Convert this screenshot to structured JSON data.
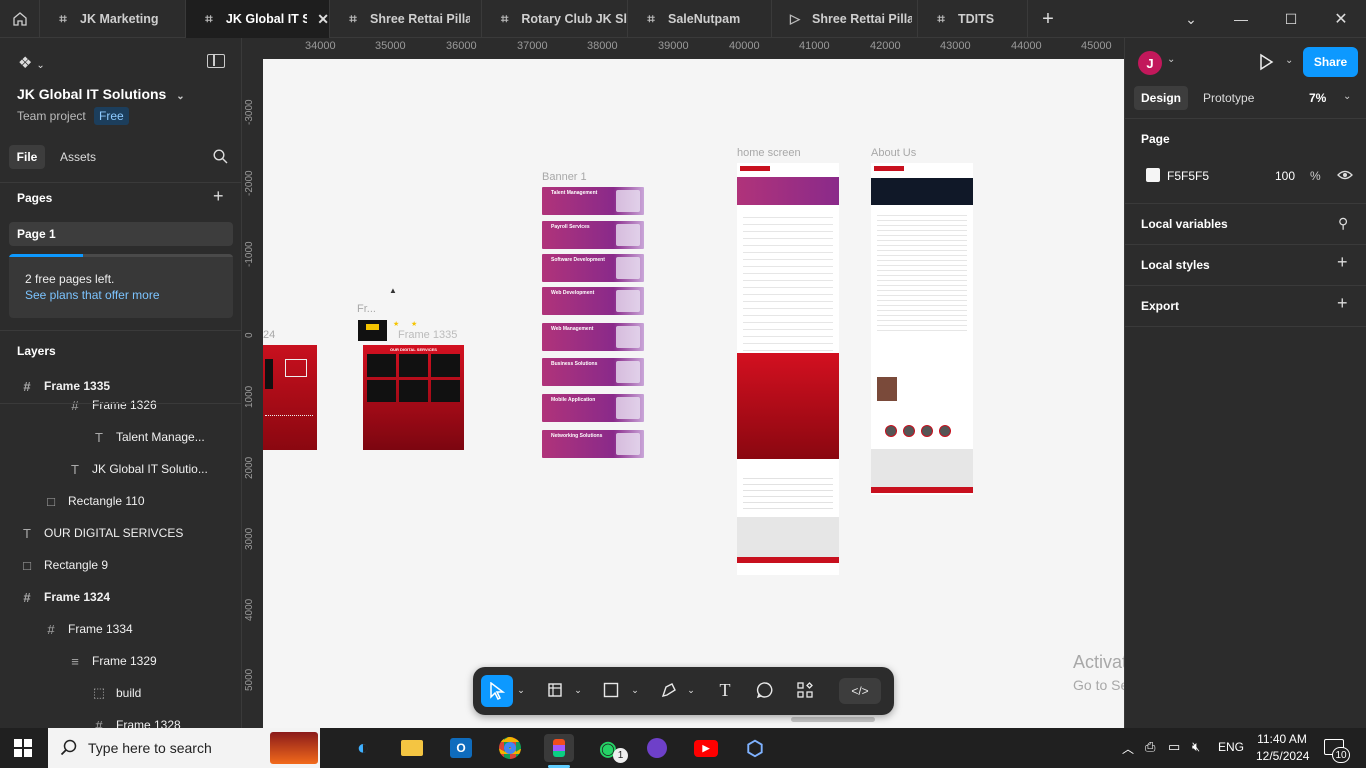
{
  "tabs": [
    {
      "label": "",
      "icon": "home-icon"
    },
    {
      "label": "JK Marketing",
      "icon": "figma-file-icon"
    },
    {
      "label": "JK Global IT So",
      "icon": "figma-file-icon",
      "active": true
    },
    {
      "label": "Shree Rettai Pillaiy",
      "icon": "figma-file-icon"
    },
    {
      "label": "Rotary Club JK Slr",
      "icon": "figma-file-icon"
    },
    {
      "label": "SaleNutpam",
      "icon": "figma-file-icon"
    },
    {
      "label": "Shree Rettai Pillaiy",
      "icon": "prototype-play-icon"
    },
    {
      "label": "TDITS",
      "icon": "figma-file-icon"
    }
  ],
  "left": {
    "file_name": "JK Global IT Solutions",
    "team": "Team project",
    "plan_badge": "Free",
    "file_tab": "File",
    "assets_tab": "Assets",
    "pages_heading": "Pages",
    "page_item": "Page 1",
    "free_pages_text": "2 free pages left.",
    "see_plans_link": "See plans that offer more",
    "free_pages_progress": 0.33,
    "layers_heading": "Layers",
    "layers": [
      {
        "label": "Frame 1335",
        "icon": "frame-icon",
        "depth": 0
      },
      {
        "label": "Frame 1326",
        "icon": "frame-icon",
        "depth": 2
      },
      {
        "label": "Talent Manage...",
        "icon": "text-icon",
        "depth": 3
      },
      {
        "label": "JK Global IT Solutio...",
        "icon": "text-icon",
        "depth": 2
      },
      {
        "label": "Rectangle 110",
        "icon": "rectangle-icon",
        "depth": 1
      },
      {
        "label": "OUR DIGITAL SERIVCES",
        "icon": "text-icon",
        "depth": 0
      },
      {
        "label": "Rectangle 9",
        "icon": "rectangle-icon",
        "depth": 0
      },
      {
        "label": "Frame 1324",
        "icon": "frame-icon",
        "depth": 0
      },
      {
        "label": "Frame 1334",
        "icon": "frame-icon",
        "depth": 1
      },
      {
        "label": "Frame 1329",
        "icon": "autolayout-icon",
        "depth": 2
      },
      {
        "label": "build",
        "icon": "component-icon",
        "depth": 3
      },
      {
        "label": "Frame 1328",
        "icon": "frame-icon",
        "depth": 3
      }
    ]
  },
  "ruler_top": [
    "34000",
    "35000",
    "36000",
    "37000",
    "38000",
    "39000",
    "40000",
    "41000",
    "42000",
    "43000",
    "44000",
    "45000"
  ],
  "ruler_left": [
    "-3000",
    "-2000",
    "-1000",
    "0",
    "1000",
    "2000",
    "3000",
    "4000",
    "5000"
  ],
  "canvas": {
    "labels": {
      "banner1": "Banner 1",
      "home": "home screen",
      "about": "About Us",
      "frame1335": "Frame 1335",
      "frame_short": "Fr...",
      "frame1324_partial": "24"
    },
    "digital_services": "OUR DIGITAL SERVICES",
    "banners": [
      "Talent Management",
      "Payroll Services",
      "Software Development",
      "Web Development",
      "Web Management",
      "Business Solutions",
      "Mobile Application",
      "Networking Solutions"
    ],
    "watermark_title": "Activate Windows",
    "watermark_sub": "Go to Settings to activate Windows."
  },
  "right": {
    "avatar_letter": "J",
    "share_label": "Share",
    "design_tab": "Design",
    "prototype_tab": "Prototype",
    "zoom": "7%",
    "page_heading": "Page",
    "page_color_hex": "F5F5F5",
    "page_opacity": "100",
    "percent_sign": "%",
    "local_variables": "Local variables",
    "local_styles": "Local styles",
    "export": "Export"
  },
  "toolbar": [
    "move-tool-icon",
    "frame-tool-icon",
    "rectangle-tool-icon",
    "pen-tool-icon",
    "text-tool-icon",
    "comment-tool-icon",
    "actions-icon",
    "dev-mode-icon"
  ],
  "help_label": "?",
  "taskbar": {
    "search_placeholder": "Type here to search",
    "lang": "ENG",
    "time": "11:40 AM",
    "date": "12/5/2024",
    "notif_count": "10",
    "whatsapp_badge": "1"
  },
  "colors": {
    "accent": "#0d99ff",
    "bg_dark": "#2c2c2c",
    "canvas_bg": "#f5f5f5",
    "brand_red": "#c8101e"
  }
}
